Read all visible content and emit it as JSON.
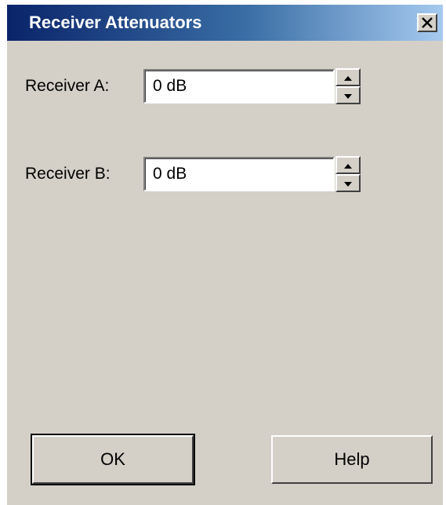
{
  "window": {
    "title": "Receiver Attenuators",
    "close_icon": "close-icon",
    "titlebar_colors": [
      "#0a246a",
      "#a6caf0"
    ],
    "face_color": "#d4d0c8"
  },
  "fields": {
    "receiver_a": {
      "label": "Receiver A:",
      "value": "0 dB",
      "spinner_icons": [
        "spin-up-icon",
        "spin-down-icon"
      ]
    },
    "receiver_b": {
      "label": "Receiver B:",
      "value": "0 dB",
      "spinner_icons": [
        "spin-up-icon",
        "spin-down-icon"
      ]
    }
  },
  "buttons": {
    "ok_label": "OK",
    "help_label": "Help"
  }
}
